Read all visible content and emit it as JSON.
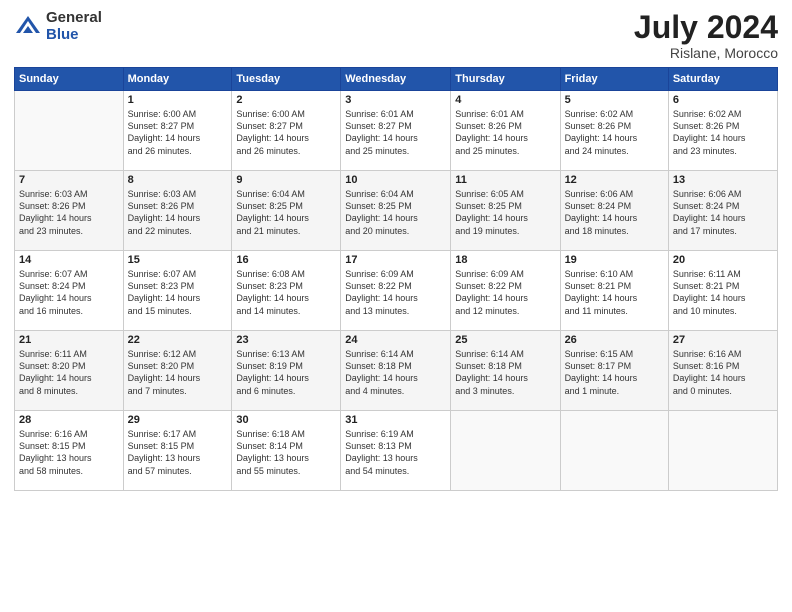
{
  "logo": {
    "general": "General",
    "blue": "Blue"
  },
  "title": {
    "month": "July 2024",
    "location": "Rislane, Morocco"
  },
  "weekdays": [
    "Sunday",
    "Monday",
    "Tuesday",
    "Wednesday",
    "Thursday",
    "Friday",
    "Saturday"
  ],
  "weeks": [
    [
      {
        "day": "",
        "info": ""
      },
      {
        "day": "1",
        "info": "Sunrise: 6:00 AM\nSunset: 8:27 PM\nDaylight: 14 hours\nand 26 minutes."
      },
      {
        "day": "2",
        "info": "Sunrise: 6:00 AM\nSunset: 8:27 PM\nDaylight: 14 hours\nand 26 minutes."
      },
      {
        "day": "3",
        "info": "Sunrise: 6:01 AM\nSunset: 8:27 PM\nDaylight: 14 hours\nand 25 minutes."
      },
      {
        "day": "4",
        "info": "Sunrise: 6:01 AM\nSunset: 8:26 PM\nDaylight: 14 hours\nand 25 minutes."
      },
      {
        "day": "5",
        "info": "Sunrise: 6:02 AM\nSunset: 8:26 PM\nDaylight: 14 hours\nand 24 minutes."
      },
      {
        "day": "6",
        "info": "Sunrise: 6:02 AM\nSunset: 8:26 PM\nDaylight: 14 hours\nand 23 minutes."
      }
    ],
    [
      {
        "day": "7",
        "info": "Sunrise: 6:03 AM\nSunset: 8:26 PM\nDaylight: 14 hours\nand 23 minutes."
      },
      {
        "day": "8",
        "info": "Sunrise: 6:03 AM\nSunset: 8:26 PM\nDaylight: 14 hours\nand 22 minutes."
      },
      {
        "day": "9",
        "info": "Sunrise: 6:04 AM\nSunset: 8:25 PM\nDaylight: 14 hours\nand 21 minutes."
      },
      {
        "day": "10",
        "info": "Sunrise: 6:04 AM\nSunset: 8:25 PM\nDaylight: 14 hours\nand 20 minutes."
      },
      {
        "day": "11",
        "info": "Sunrise: 6:05 AM\nSunset: 8:25 PM\nDaylight: 14 hours\nand 19 minutes."
      },
      {
        "day": "12",
        "info": "Sunrise: 6:06 AM\nSunset: 8:24 PM\nDaylight: 14 hours\nand 18 minutes."
      },
      {
        "day": "13",
        "info": "Sunrise: 6:06 AM\nSunset: 8:24 PM\nDaylight: 14 hours\nand 17 minutes."
      }
    ],
    [
      {
        "day": "14",
        "info": "Sunrise: 6:07 AM\nSunset: 8:24 PM\nDaylight: 14 hours\nand 16 minutes."
      },
      {
        "day": "15",
        "info": "Sunrise: 6:07 AM\nSunset: 8:23 PM\nDaylight: 14 hours\nand 15 minutes."
      },
      {
        "day": "16",
        "info": "Sunrise: 6:08 AM\nSunset: 8:23 PM\nDaylight: 14 hours\nand 14 minutes."
      },
      {
        "day": "17",
        "info": "Sunrise: 6:09 AM\nSunset: 8:22 PM\nDaylight: 14 hours\nand 13 minutes."
      },
      {
        "day": "18",
        "info": "Sunrise: 6:09 AM\nSunset: 8:22 PM\nDaylight: 14 hours\nand 12 minutes."
      },
      {
        "day": "19",
        "info": "Sunrise: 6:10 AM\nSunset: 8:21 PM\nDaylight: 14 hours\nand 11 minutes."
      },
      {
        "day": "20",
        "info": "Sunrise: 6:11 AM\nSunset: 8:21 PM\nDaylight: 14 hours\nand 10 minutes."
      }
    ],
    [
      {
        "day": "21",
        "info": "Sunrise: 6:11 AM\nSunset: 8:20 PM\nDaylight: 14 hours\nand 8 minutes."
      },
      {
        "day": "22",
        "info": "Sunrise: 6:12 AM\nSunset: 8:20 PM\nDaylight: 14 hours\nand 7 minutes."
      },
      {
        "day": "23",
        "info": "Sunrise: 6:13 AM\nSunset: 8:19 PM\nDaylight: 14 hours\nand 6 minutes."
      },
      {
        "day": "24",
        "info": "Sunrise: 6:14 AM\nSunset: 8:18 PM\nDaylight: 14 hours\nand 4 minutes."
      },
      {
        "day": "25",
        "info": "Sunrise: 6:14 AM\nSunset: 8:18 PM\nDaylight: 14 hours\nand 3 minutes."
      },
      {
        "day": "26",
        "info": "Sunrise: 6:15 AM\nSunset: 8:17 PM\nDaylight: 14 hours\nand 1 minute."
      },
      {
        "day": "27",
        "info": "Sunrise: 6:16 AM\nSunset: 8:16 PM\nDaylight: 14 hours\nand 0 minutes."
      }
    ],
    [
      {
        "day": "28",
        "info": "Sunrise: 6:16 AM\nSunset: 8:15 PM\nDaylight: 13 hours\nand 58 minutes."
      },
      {
        "day": "29",
        "info": "Sunrise: 6:17 AM\nSunset: 8:15 PM\nDaylight: 13 hours\nand 57 minutes."
      },
      {
        "day": "30",
        "info": "Sunrise: 6:18 AM\nSunset: 8:14 PM\nDaylight: 13 hours\nand 55 minutes."
      },
      {
        "day": "31",
        "info": "Sunrise: 6:19 AM\nSunset: 8:13 PM\nDaylight: 13 hours\nand 54 minutes."
      },
      {
        "day": "",
        "info": ""
      },
      {
        "day": "",
        "info": ""
      },
      {
        "day": "",
        "info": ""
      }
    ]
  ]
}
